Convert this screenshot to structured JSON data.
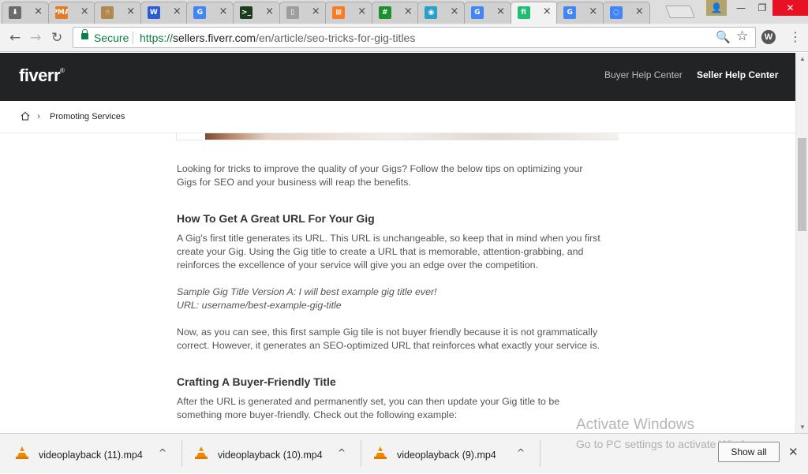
{
  "browser": {
    "tabs": [
      {
        "icon": "download-icon",
        "color": "#6b6b6b",
        "glyph": "⬇"
      },
      {
        "icon": "pma-icon",
        "color": "#e07b28",
        "glyph": "PMA"
      },
      {
        "icon": "hand-cursor-icon",
        "color": "#b08850",
        "glyph": "☝"
      },
      {
        "icon": "w-icon",
        "color": "#2b5bd7",
        "glyph": "W"
      },
      {
        "icon": "google-icon",
        "color": "#4285f4",
        "glyph": "G"
      },
      {
        "icon": "terminal-icon",
        "color": "#1d3b1d",
        "glyph": ">_"
      },
      {
        "icon": "page-icon",
        "color": "#9e9e9e",
        "glyph": "▯"
      },
      {
        "icon": "xampp-icon",
        "color": "#fb7a24",
        "glyph": "⊠"
      },
      {
        "icon": "grid-icon",
        "color": "#1e8f2f",
        "glyph": "#"
      },
      {
        "icon": "wave-icon",
        "color": "#2aa0c9",
        "glyph": "◉"
      },
      {
        "icon": "google-icon",
        "color": "#4285f4",
        "glyph": "G"
      },
      {
        "icon": "fiverr-icon",
        "color": "#1dbf73",
        "glyph": "fi"
      },
      {
        "icon": "google-icon",
        "color": "#4285f4",
        "glyph": "G"
      },
      {
        "icon": "loading-icon",
        "color": "#4285f4",
        "glyph": "◌"
      }
    ],
    "tab_close": "×",
    "url": {
      "secure_label": "Secure",
      "scheme": "https://",
      "host": "sellers.fiverr.com",
      "path": "/en/article/seo-tricks-for-gig-titles"
    },
    "window": {
      "minimize": "—",
      "maximize": "❐",
      "close": "✕",
      "profile": "👤"
    },
    "nav": {
      "back": "←",
      "forward": "→",
      "reload": "↻"
    },
    "omni_icons": {
      "search": "🔍",
      "star": "☆"
    },
    "extension_label": "W",
    "menu_glyph": "⋮"
  },
  "site": {
    "logo": "fiverr",
    "logo_mark": "®",
    "links": {
      "buyer": "Buyer Help Center",
      "seller": "Seller Help Center"
    },
    "breadcrumb": {
      "separator": "›",
      "current": "Promoting Services"
    }
  },
  "article": {
    "intro": [
      "Looking for tricks to improve the quality of your Gigs? Follow the below tips on optimizing your",
      "Gigs for SEO and your business will reap the benefits."
    ],
    "h1": "How To Get A Great URL For Your Gig",
    "p1": [
      "A Gig's first title generates its URL. This URL is unchangeable, so keep that in mind when you first",
      "create your Gig. Using the Gig title to create a URL that is memorable, attention-grabbing, and",
      "reinforces the excellence of your service will give you an edge over the competition."
    ],
    "sample": [
      "Sample Gig Title Version A: I will best example gig title ever!",
      "URL: username/best-example-gig-title"
    ],
    "p2": [
      "Now, as you can see, this first sample Gig tile is not buyer friendly because it is not grammatically",
      "correct. However, it generates an SEO-optimized URL that reinforces what exactly your service is."
    ],
    "h2": "Crafting A Buyer-Friendly Title",
    "p3": [
      "After the URL is generated and permanently set, you can then update your Gig title to be",
      "something more buyer-friendly. Check out the following example:"
    ]
  },
  "watermark": {
    "title": "Activate Windows",
    "subtitle": "Go to PC settings to activate Windows."
  },
  "downloads": {
    "items": [
      {
        "name": "videoplayback (11).mp4"
      },
      {
        "name": "videoplayback (10).mp4"
      },
      {
        "name": "videoplayback (9).mp4"
      }
    ],
    "chevron": "^",
    "show_all": "Show all",
    "close": "✕"
  },
  "scrollbar": {
    "up": "▲",
    "down": "▼"
  }
}
